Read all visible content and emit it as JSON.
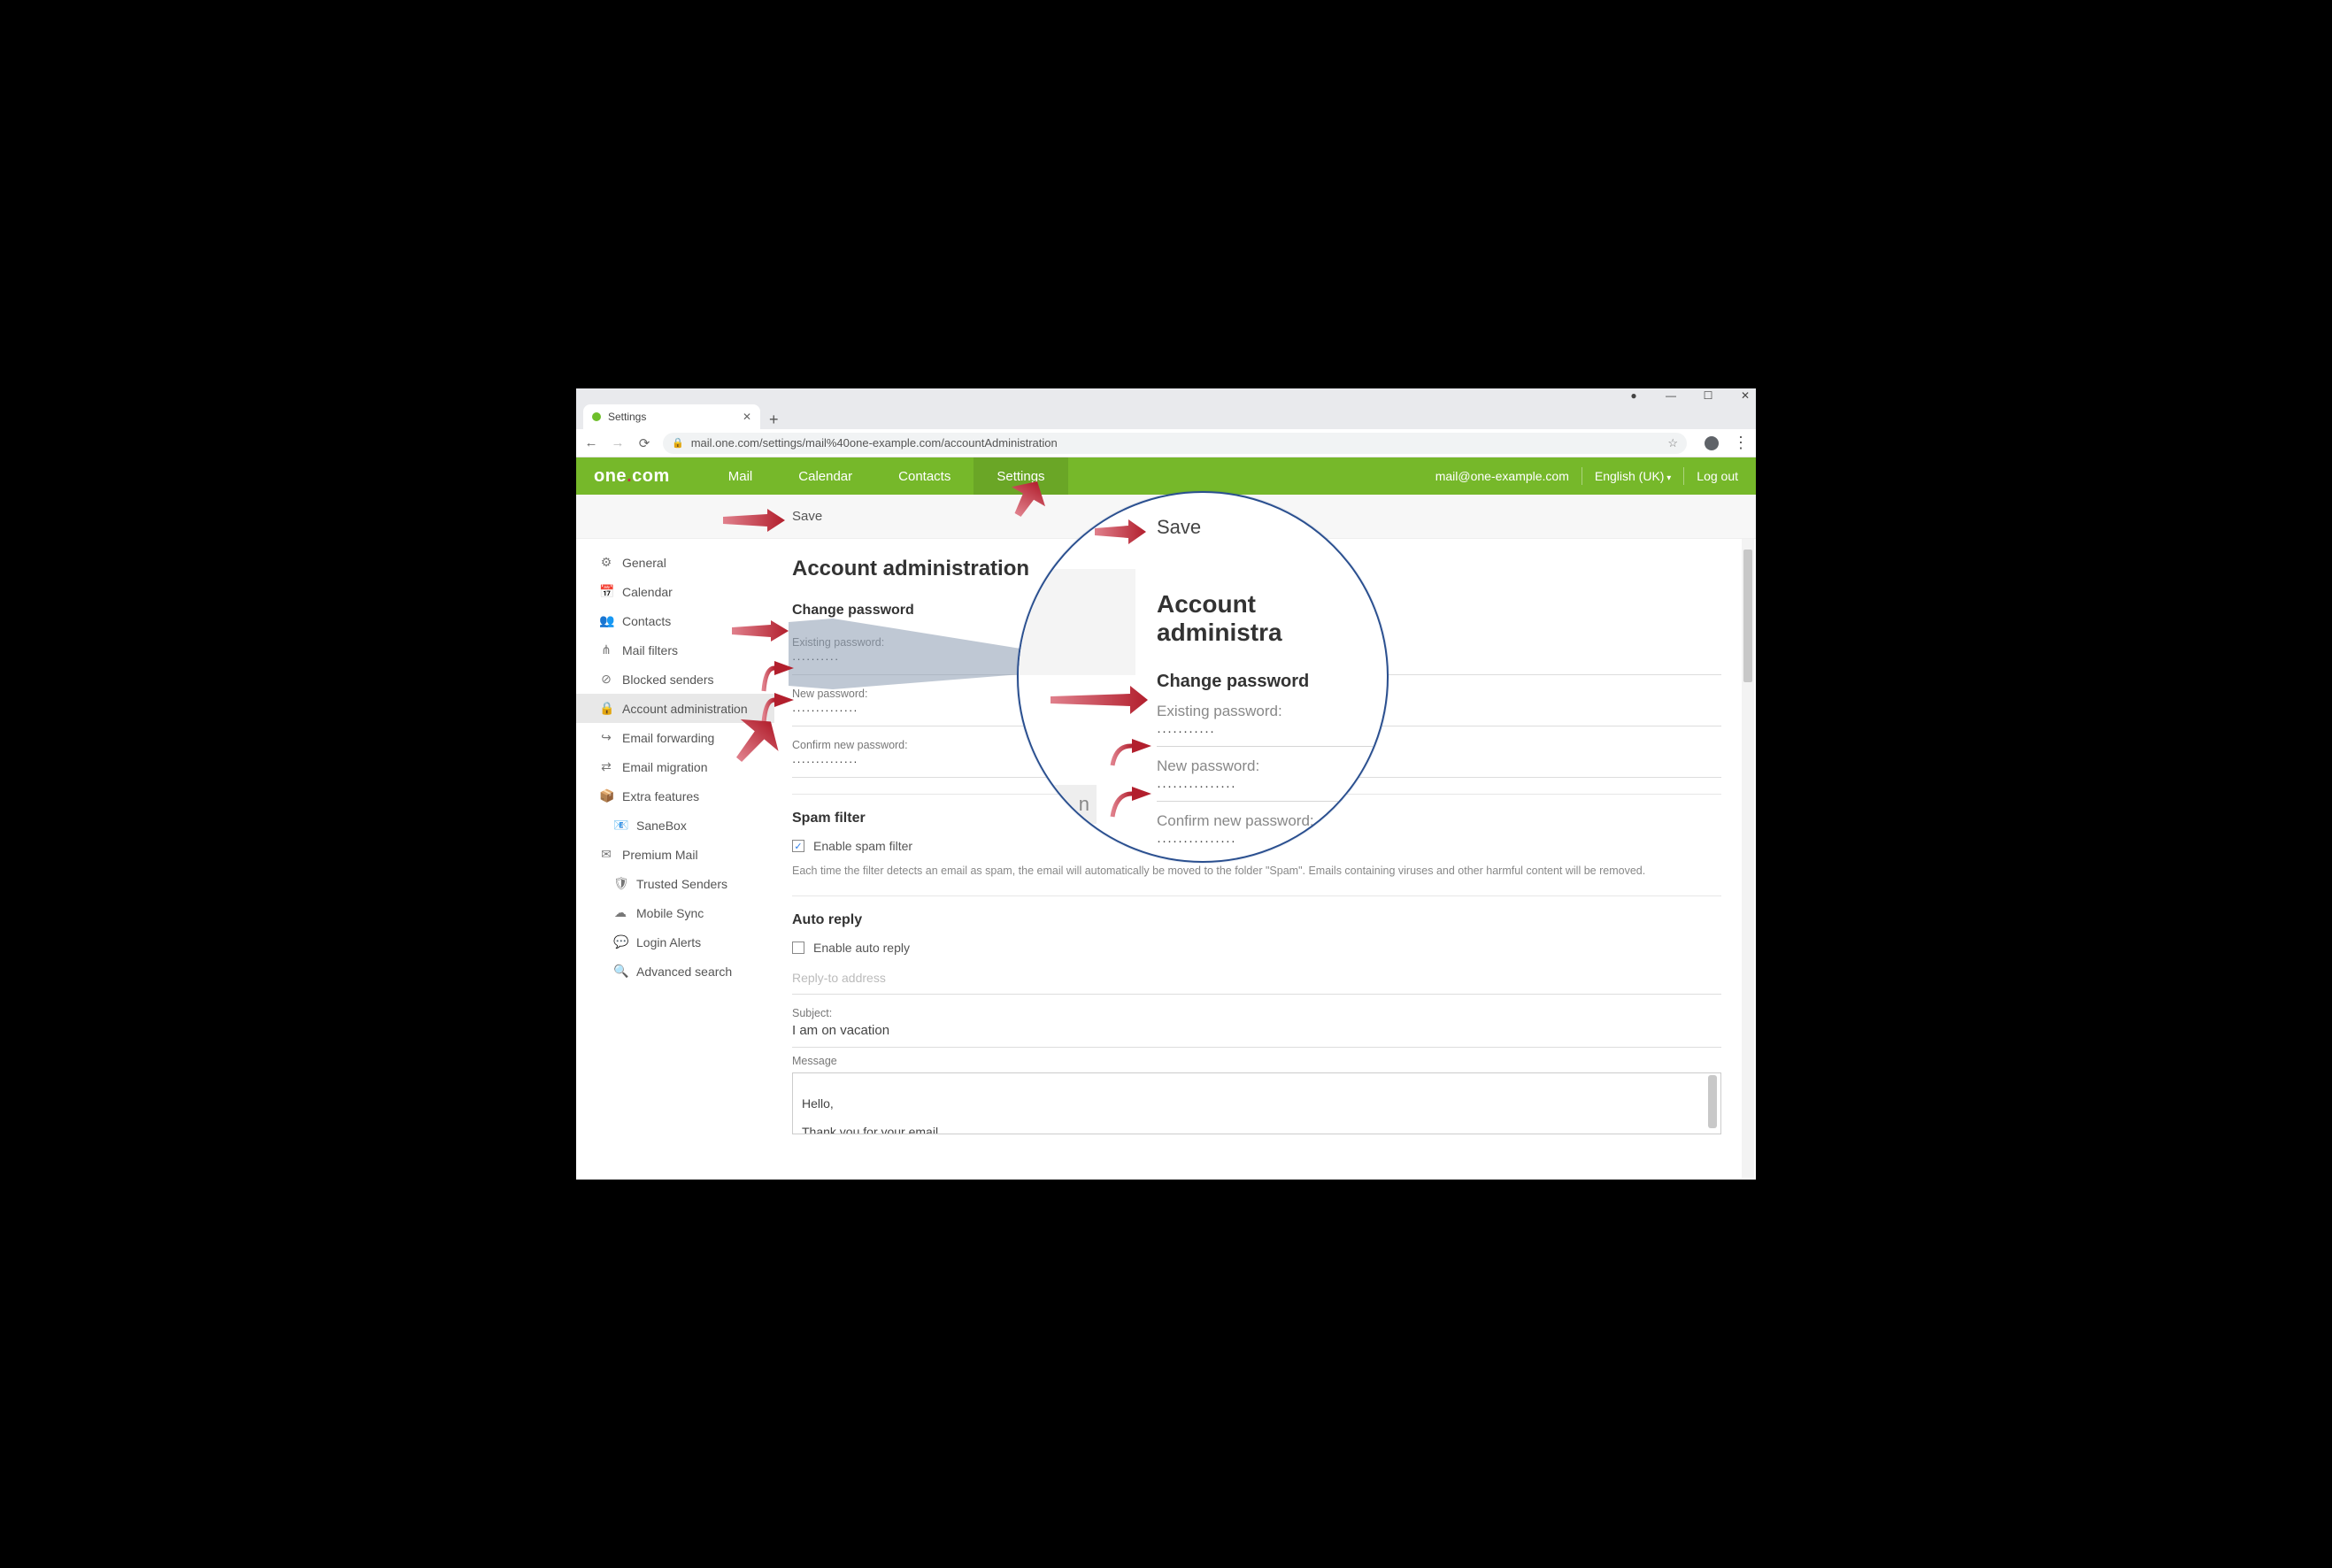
{
  "browser": {
    "tab_title": "Settings",
    "url": "mail.one.com/settings/mail%40one-example.com/accountAdministration"
  },
  "apphdr": {
    "logo_text_1": "one",
    "logo_text_2": "com",
    "tabs": [
      "Mail",
      "Calendar",
      "Contacts",
      "Settings"
    ],
    "email": "mail@one-example.com",
    "language": "English (UK)",
    "logout": "Log out"
  },
  "savebar": {
    "label": "Save"
  },
  "sidebar": {
    "items": [
      {
        "icon": "⚙",
        "label": "General"
      },
      {
        "icon": "📅",
        "label": "Calendar"
      },
      {
        "icon": "👥",
        "label": "Contacts"
      },
      {
        "icon": "⋔",
        "label": "Mail filters"
      },
      {
        "icon": "⊘",
        "label": "Blocked senders"
      },
      {
        "icon": "🔒",
        "label": "Account administration",
        "active": true
      },
      {
        "icon": "↪",
        "label": "Email forwarding"
      },
      {
        "icon": "⇄",
        "label": "Email migration"
      },
      {
        "icon": "📦",
        "label": "Extra features"
      },
      {
        "icon": "📧",
        "label": "SaneBox",
        "sub": true
      },
      {
        "icon": "✉",
        "label": "Premium Mail"
      },
      {
        "icon": "🛡",
        "label": "Trusted Senders",
        "sub": true
      },
      {
        "icon": "☁",
        "label": "Mobile Sync",
        "sub": true
      },
      {
        "icon": "💬",
        "label": "Login Alerts",
        "sub": true
      },
      {
        "icon": "🔍",
        "label": "Advanced search",
        "sub": true
      }
    ]
  },
  "main": {
    "title": "Account administration",
    "pw_section": "Change password",
    "existing_lbl": "Existing password:",
    "existing_val": "··········",
    "new_lbl": "New password:",
    "new_val": "··············",
    "confirm_lbl": "Confirm new password:",
    "confirm_val": "··············",
    "spam_title": "Spam filter",
    "spam_enable": "Enable spam filter",
    "spam_desc": "Each time the filter detects an email as spam, the email will automatically be moved to the folder \"Spam\". Emails containing viruses and other harmful content will be removed.",
    "auto_title": "Auto reply",
    "auto_enable": "Enable auto reply",
    "replyto_placeholder": "Reply-to address",
    "subject_lbl": "Subject:",
    "subject_val": "I am on vacation",
    "message_lbl": "Message",
    "message_val": "Hello,\n\nThank you for your email."
  },
  "mag": {
    "save": "Save",
    "title": "Account administra",
    "pw": "Change password",
    "existing_lbl": "Existing password:",
    "existing_val": "···········",
    "new_lbl": "New password:",
    "new_val": "···············",
    "confirm_lbl": "Confirm new password:",
    "confirm_val": "···············",
    "n": "n"
  }
}
